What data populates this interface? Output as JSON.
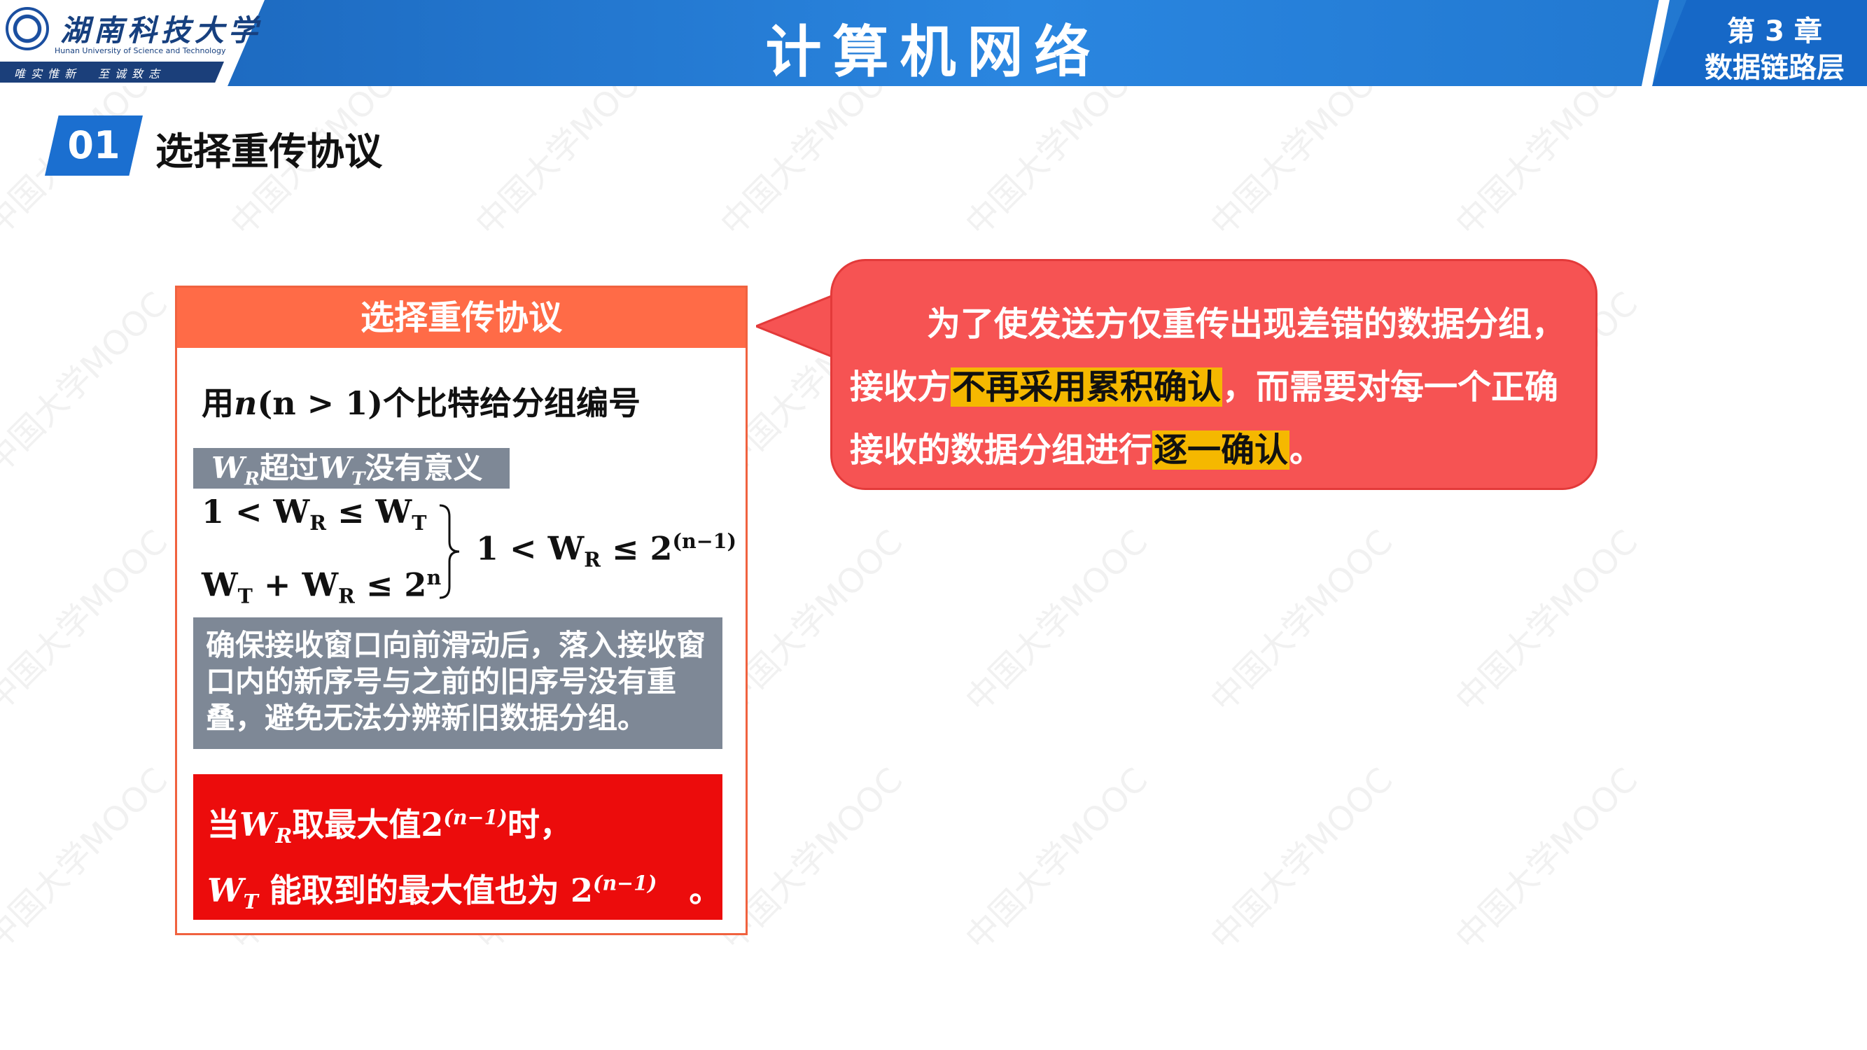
{
  "header": {
    "university_name": "湖南科技大学",
    "university_en": "Hunan University of Science and Technology",
    "motto": "唯实惟新　至诚致志",
    "course_title": "计算机网络",
    "chapter_line1": "第 3 章",
    "chapter_line2": "数据链路层"
  },
  "section": {
    "number": "01",
    "title": "选择重传协议"
  },
  "card": {
    "title": "选择重传协议",
    "line_n_prefix": "用",
    "line_n_math": "n",
    "line_n_cond": "(n > 1)",
    "line_n_suffix": "个比特给分组编号",
    "tag_wr": "W",
    "tag_wr_sub": "R",
    "tag_mid": "超过",
    "tag_wt": "W",
    "tag_wt_sub": "T",
    "tag_end": "没有意义",
    "eq1": "1 < W",
    "eq1_sub": "R",
    "eq1_mid": " ≤ W",
    "eq1_sub2": "T",
    "eq2": "W",
    "eq2_sub": "T",
    "eq2_mid": " + W",
    "eq2_sub2": "R",
    "eq2_end": " ≤ 2",
    "eq2_sup": "n",
    "eq3": "1 < W",
    "eq3_sub": "R",
    "eq3_mid": " ≤ 2",
    "eq3_sup": "(n−1)",
    "grey_box_text": "确保接收窗口向前滑动后，落入接收窗口内的新序号与之前的旧序号没有重叠，避免无法分辨新旧数据分组。",
    "red_l1_pre": "当",
    "red_l1_w": "W",
    "red_l1_sub": "R",
    "red_l1_mid": "取最大值",
    "red_l1_val": "2",
    "red_l1_sup": "(n−1)",
    "red_l1_end": "时，",
    "red_l2_w": "W",
    "red_l2_sub": "T",
    "red_l2_mid": " 能取到的最大值也为 ",
    "red_l2_val": "2",
    "red_l2_sup": "(n−1)",
    "red_l2_end": "　。"
  },
  "callout": {
    "part1": "为了使发送方仅重传出现差错的数据分组，接收方",
    "highlight1": "不再采用累积确认",
    "part2": "，而需要对每一个正确接收的数据分组进行",
    "highlight2": "逐一确认",
    "part3": "。"
  },
  "watermark": "中国大学MOOC",
  "colors": {
    "header_blue": "#1f74cc",
    "section_blue": "#1b6fd0",
    "card_head": "#ff6b47",
    "grey_box": "#7e8896",
    "red_box": "#ec0c0c",
    "callout": "#f65353",
    "highlight": "#f5b800"
  }
}
